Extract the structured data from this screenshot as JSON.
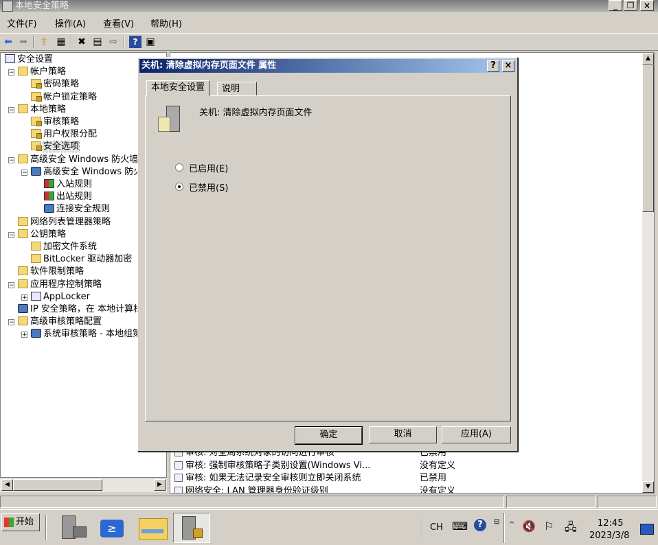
{
  "window": {
    "title": "本地安全策略"
  },
  "menu": [
    "文件(F)",
    "操作(A)",
    "查看(V)",
    "帮助(H)"
  ],
  "tree": [
    {
      "label": "安全设置",
      "icon": "doc-icon",
      "indent": 0,
      "expand": ""
    },
    {
      "label": "帐户策略",
      "icon": "folder-icon",
      "indent": 1,
      "expand": "⊟"
    },
    {
      "label": "密码策略",
      "icon": "lock-folder-icon",
      "indent": 2,
      "expand": ""
    },
    {
      "label": "帐户锁定策略",
      "icon": "lock-folder-icon",
      "indent": 2,
      "expand": ""
    },
    {
      "label": "本地策略",
      "icon": "folder-icon",
      "indent": 1,
      "expand": "⊟"
    },
    {
      "label": "审核策略",
      "icon": "lock-folder-icon",
      "indent": 2,
      "expand": ""
    },
    {
      "label": "用户权限分配",
      "icon": "lock-folder-icon",
      "indent": 2,
      "expand": ""
    },
    {
      "label": "安全选项",
      "icon": "lock-folder-icon",
      "indent": 2,
      "expand": "",
      "selected": true
    },
    {
      "label": "高级安全 Windows 防火墙",
      "icon": "folder-icon",
      "indent": 1,
      "expand": "⊟"
    },
    {
      "label": "高级安全 Windows 防火墙 - 本地组策略对象",
      "icon": "shield-icon",
      "indent": 2,
      "expand": "⊟"
    },
    {
      "label": "入站规则",
      "icon": "rule-icon",
      "indent": 3,
      "expand": ""
    },
    {
      "label": "出站规则",
      "icon": "rule-icon",
      "indent": 3,
      "expand": ""
    },
    {
      "label": "连接安全规则",
      "icon": "shield-icon",
      "indent": 3,
      "expand": ""
    },
    {
      "label": "网络列表管理器策略",
      "icon": "folder-icon",
      "indent": 1,
      "expand": ""
    },
    {
      "label": "公钥策略",
      "icon": "folder-icon",
      "indent": 1,
      "expand": "⊟"
    },
    {
      "label": "加密文件系统",
      "icon": "folder-icon",
      "indent": 2,
      "expand": ""
    },
    {
      "label": "BitLocker 驱动器加密",
      "icon": "folder-icon",
      "indent": 2,
      "expand": ""
    },
    {
      "label": "软件限制策略",
      "icon": "folder-icon",
      "indent": 1,
      "expand": ""
    },
    {
      "label": "应用程序控制策略",
      "icon": "folder-icon",
      "indent": 1,
      "expand": "⊟"
    },
    {
      "label": "AppLocker",
      "icon": "doc-icon",
      "indent": 2,
      "expand": "⊞"
    },
    {
      "label": "IP 安全策略，在 本地计算机",
      "icon": "shield-icon",
      "indent": 1,
      "expand": ""
    },
    {
      "label": "高级审核策略配置",
      "icon": "folder-icon",
      "indent": 1,
      "expand": "⊟"
    },
    {
      "label": "系统审核策略 - 本地组策略对象",
      "icon": "shield-icon",
      "indent": 2,
      "expand": "⊞"
    }
  ],
  "list_rows": [
    {
      "policy": "审核: 对全局系统对象的访问进行审核",
      "value": "已禁用"
    },
    {
      "policy": "审核: 强制审核策略子类别设置(Windows Vi...",
      "value": "没有定义"
    },
    {
      "policy": "审核: 如果无法记录安全审核则立即关闭系统",
      "value": "已禁用"
    },
    {
      "policy": "网络安全: LAN 管理器身份验证级别",
      "value": "没有定义"
    }
  ],
  "dialog": {
    "title": "关机: 清除虚拟内存页面文件 属性",
    "help_btn": "?",
    "close_btn": "×",
    "tabs": [
      "本地安全设置",
      "说明"
    ],
    "policy_name": "关机: 清除虚拟内存页面文件",
    "options": [
      {
        "label": "已启用(E)",
        "checked": false
      },
      {
        "label": "已禁用(S)",
        "checked": true
      }
    ],
    "buttons": {
      "ok": "确定",
      "cancel": "取消",
      "apply": "应用(A)"
    }
  },
  "taskbar": {
    "start": "开始",
    "lang": "CH",
    "time": "12:45",
    "date": "2023/3/8"
  }
}
